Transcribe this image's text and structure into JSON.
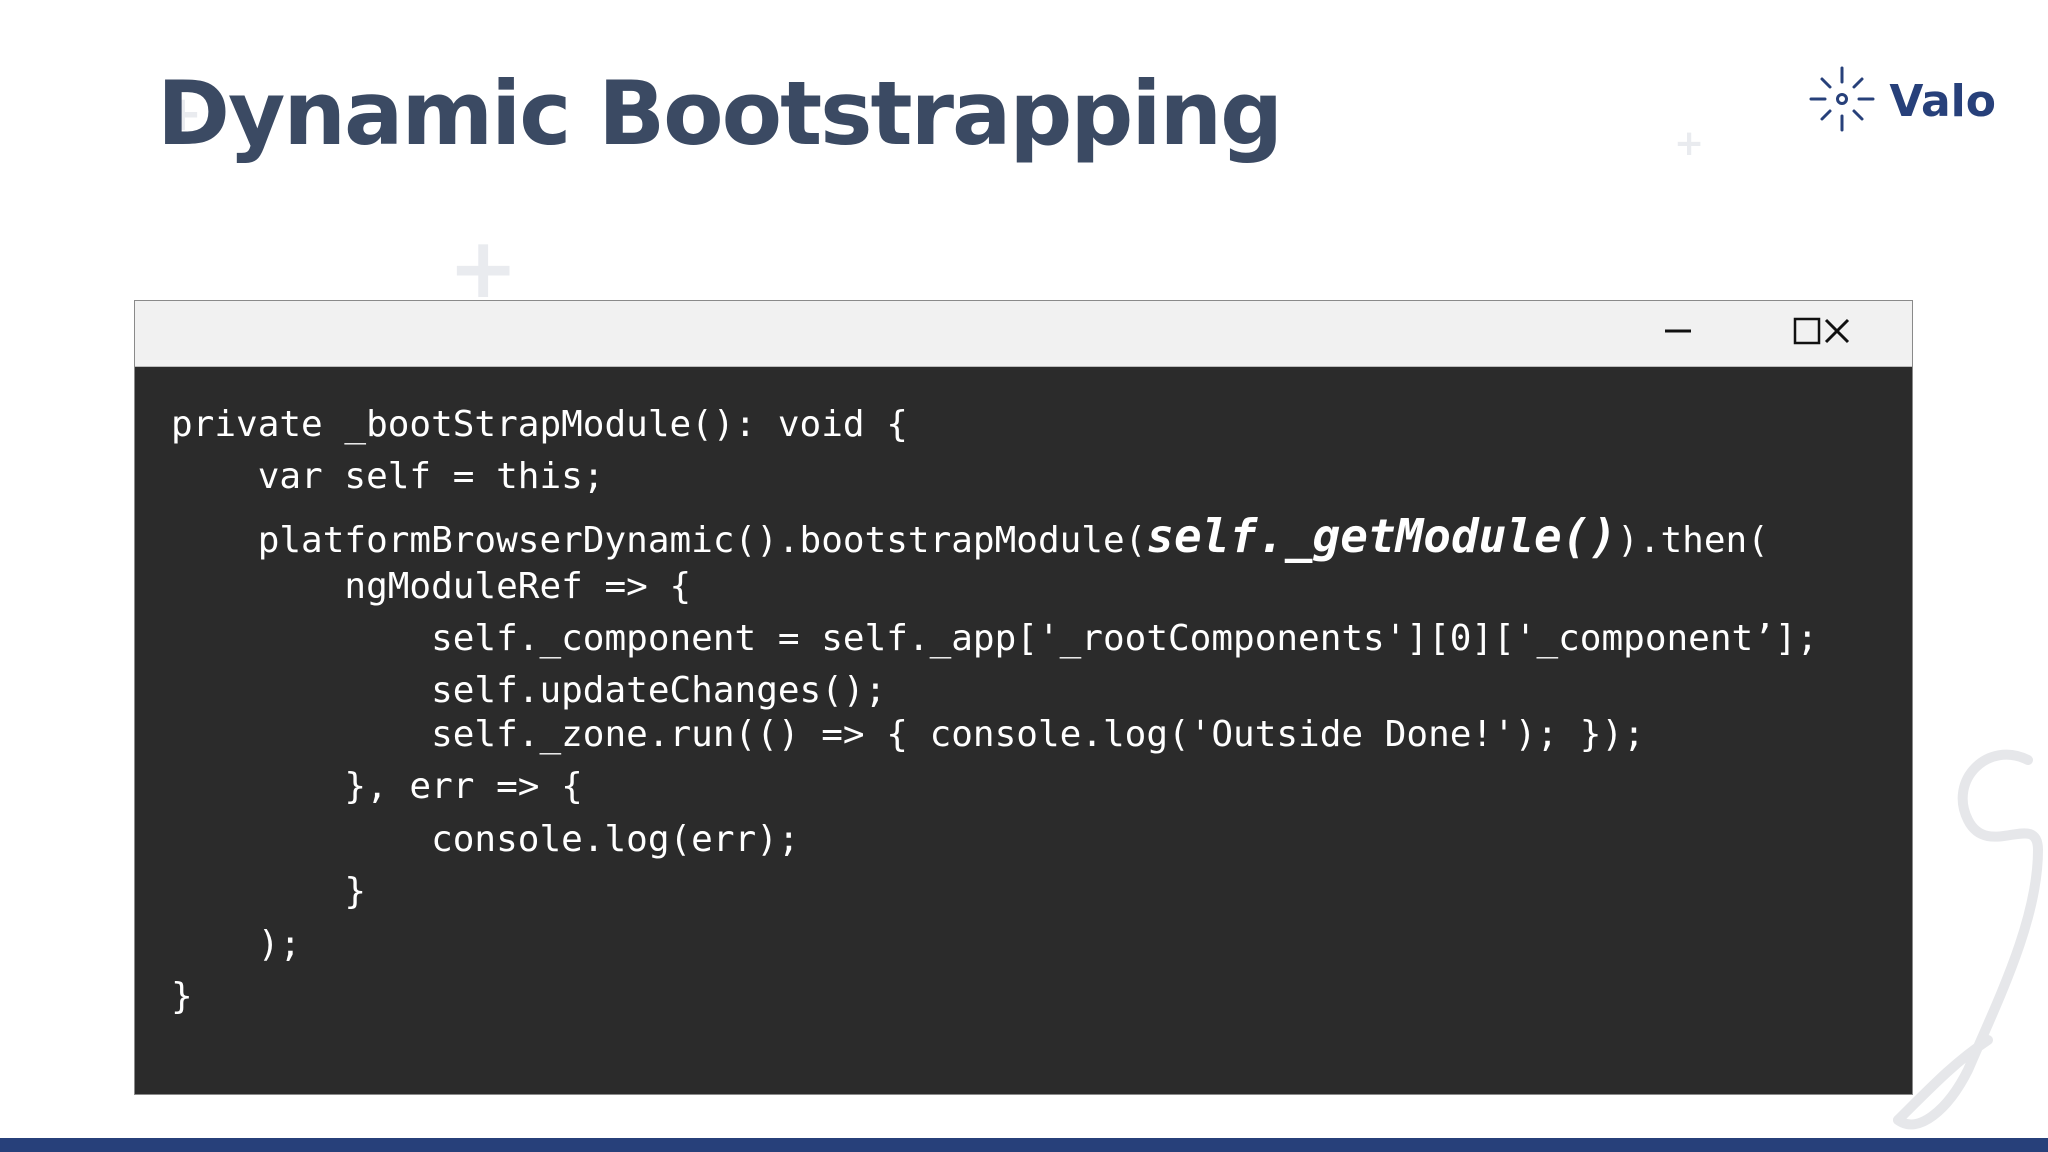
{
  "slide": {
    "title": "Dynamic Bootstrapping"
  },
  "logo": {
    "text": "Valo",
    "icon": "sparkle-logo-icon",
    "color": "#27407a"
  },
  "window": {
    "controls": {
      "minimize_icon": "minimize-icon",
      "maximize_icon": "maximize-icon",
      "close_icon": "close-icon"
    },
    "code_lines": [
      {
        "pre": "private _bootStrapModule(): void {",
        "em": "",
        "post": ""
      },
      {
        "pre": "    var self = this;",
        "em": "",
        "post": ""
      },
      {
        "pre": "    platformBrowserDynamic().bootstrapModule(",
        "em": "self._getModule()",
        "post": ").then("
      },
      {
        "pre": "        ngModuleRef => {",
        "em": "",
        "post": ""
      },
      {
        "pre": "            self._component = self._app['_rootComponents'][0]['_component’];",
        "em": "",
        "post": ""
      },
      {
        "pre": "            self.updateChanges();",
        "em": "",
        "post": ""
      },
      {
        "pre": "            self._zone.run(() => { console.log('Outside Done!'); });",
        "em": "",
        "post": ""
      },
      {
        "pre": "        }, err => {",
        "em": "",
        "post": ""
      },
      {
        "pre": "            console.log(err);",
        "em": "",
        "post": ""
      },
      {
        "pre": "        }",
        "em": "",
        "post": ""
      },
      {
        "pre": "    );",
        "em": "",
        "post": ""
      },
      {
        "pre": "}",
        "em": "",
        "post": ""
      }
    ]
  },
  "colors": {
    "title": "#3b4a63",
    "code_background": "#2b2b2b",
    "titlebar": "#f1f1f1",
    "accent_bar": "#27407a"
  }
}
